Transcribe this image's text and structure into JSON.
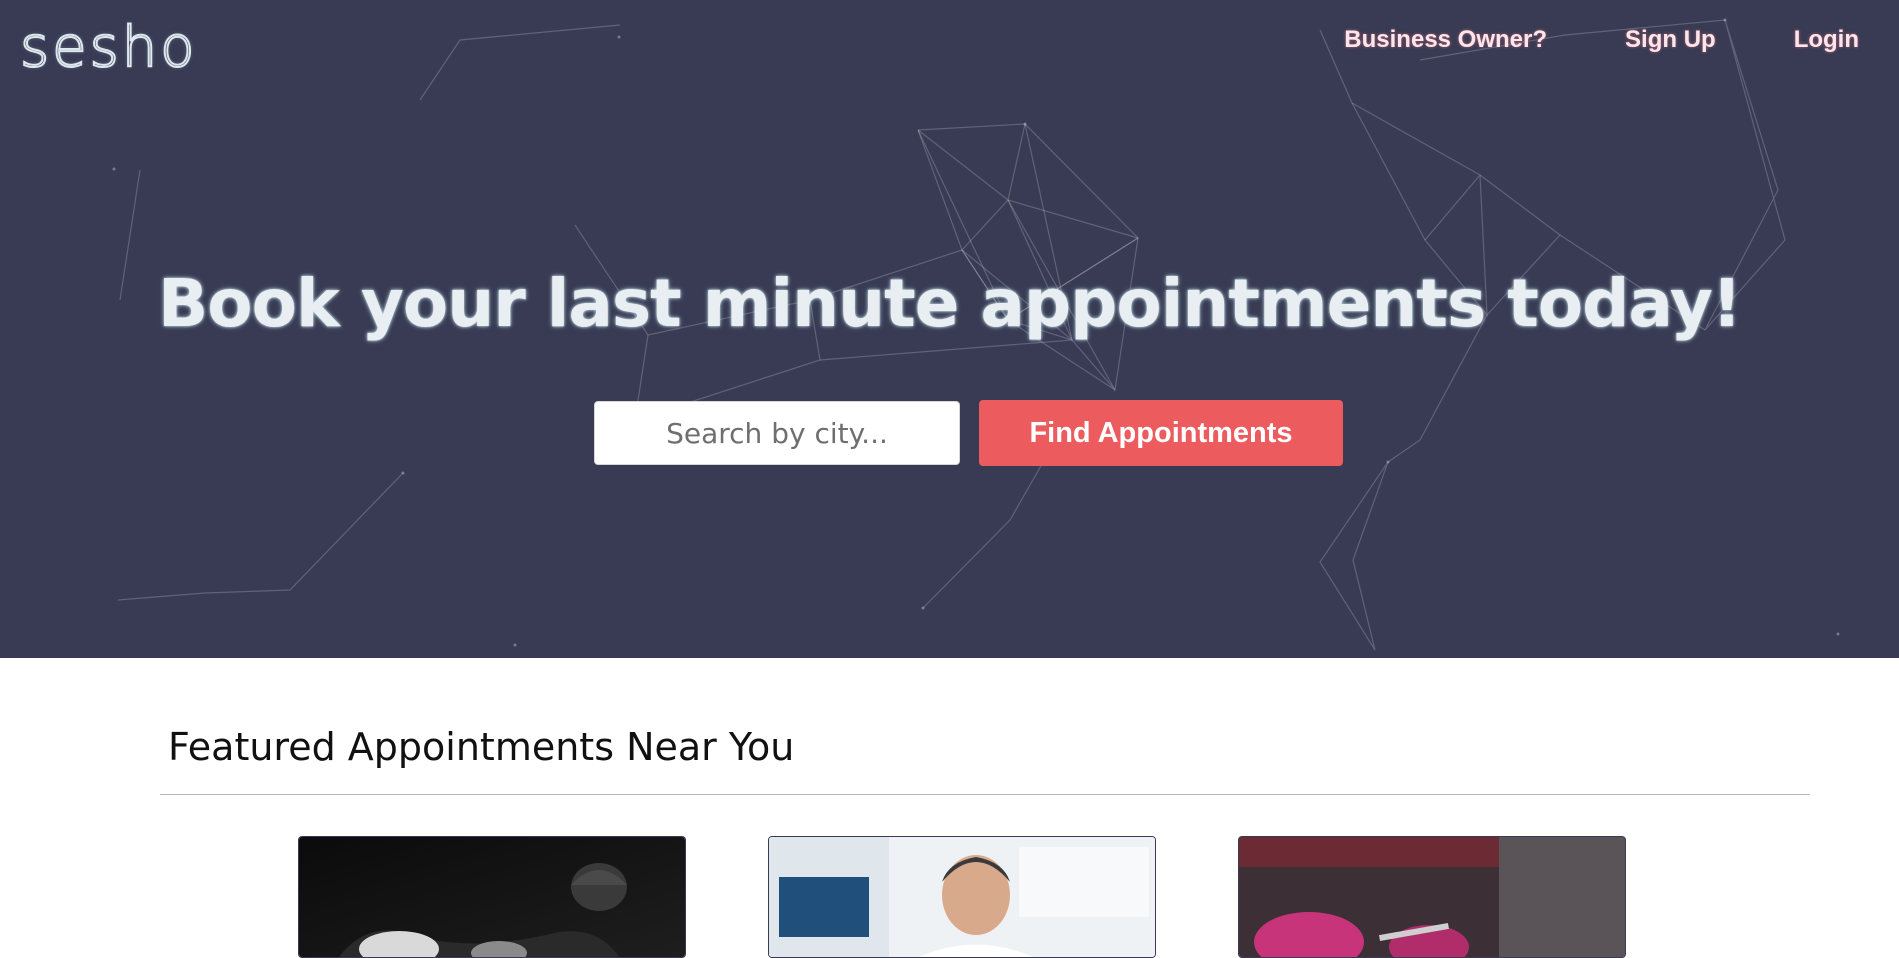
{
  "header": {
    "logo_text": "sesho",
    "nav": [
      {
        "label": "Business Owner?"
      },
      {
        "label": "Sign Up"
      },
      {
        "label": "Login"
      }
    ]
  },
  "hero": {
    "headline": "Book your last minute appointments today!",
    "search": {
      "placeholder": "Search by city...",
      "value": ""
    },
    "find_button_label": "Find Appointments",
    "background_color": "#383b53",
    "accent_color": "#ec5b5e"
  },
  "featured": {
    "title": "Featured Appointments Near You",
    "cards": [
      {
        "image": "boxer-photo"
      },
      {
        "image": "smiling-man-photo"
      },
      {
        "image": "gloved-hands-photo"
      }
    ]
  }
}
